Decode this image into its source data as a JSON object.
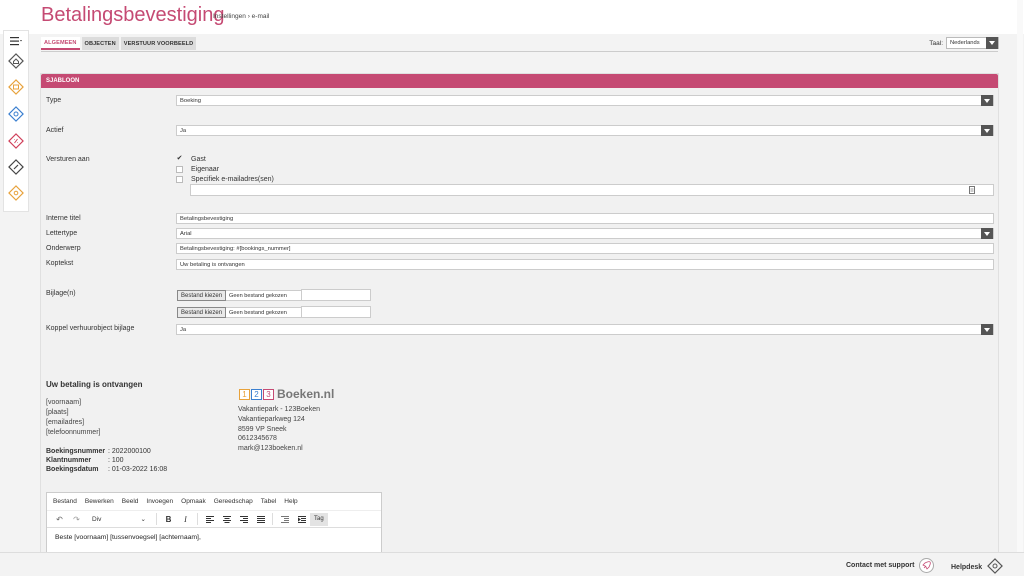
{
  "header": {
    "title": "Betalingsbevestiging",
    "breadcrumb": "Instellingen › e-mail"
  },
  "tabs": [
    {
      "label": "ALGEMEEN",
      "active": true
    },
    {
      "label": "OBJECTEN",
      "active": false
    },
    {
      "label": "VERSTUUR VOORBEELD",
      "active": false
    }
  ],
  "language": {
    "label": "Taal:",
    "value": "Nederlands"
  },
  "section": {
    "title": "SJABLOON"
  },
  "form": {
    "type": {
      "label": "Type",
      "value": "Boeking"
    },
    "actief": {
      "label": "Actief",
      "value": "Ja"
    },
    "versturen": {
      "label": "Versturen aan",
      "options": [
        {
          "label": "Gast",
          "checked": true
        },
        {
          "label": "Eigenaar",
          "checked": false
        },
        {
          "label": "Specifiek e-mailadres(sen)",
          "checked": false
        }
      ],
      "email_value": ""
    },
    "interne_titel": {
      "label": "Interne titel",
      "value": "Betalingsbevestiging"
    },
    "lettertype": {
      "label": "Lettertype",
      "value": "Arial"
    },
    "onderwerp": {
      "label": "Onderwerp",
      "value": "Betalingsbevestiging: #[bookings_nummer]"
    },
    "koptekst": {
      "label": "Koptekst",
      "value": "Uw betaling is ontvangen"
    },
    "bijlagen": {
      "label": "Bijlage(n)",
      "button": "Bestand kiezen",
      "none_chosen": "Geen bestand gekozen"
    },
    "koppel": {
      "label": "Koppel verhuurobject bijlage",
      "value": "Ja"
    }
  },
  "preview": {
    "title": "Uw betaling is ontvangen",
    "placeholders": [
      "[voornaam]",
      "[plaats]",
      "[emailadres]",
      "[telefoonnummer]"
    ],
    "details": [
      {
        "key": "Boekingsnummer",
        "value": ": 2022000100"
      },
      {
        "key": "Klantnummer",
        "value": ": 100"
      },
      {
        "key": "Boekingsdatum",
        "value": ": 01-03-2022 16:08"
      }
    ],
    "logo": {
      "d1": "1",
      "d2": "2",
      "d3": "3",
      "brand": "Boeken.nl"
    },
    "address": [
      "Vakantiepark - 123Boeken",
      "Vakantieparkweg 124",
      "8599 VP Sneek",
      "0612345678",
      "mark@123boeken.nl"
    ]
  },
  "editor": {
    "menu": [
      "Bestand",
      "Bewerken",
      "Beeld",
      "Invoegen",
      "Opmaak",
      "Gereedschap",
      "Tabel",
      "Help"
    ],
    "format": "Div",
    "tag_button": "Tag",
    "body": "Beste [voornaam] [tussenvoegsel] [achternaam],"
  },
  "footer": {
    "support": "Contact met support",
    "helpdesk": "Helpdesk"
  },
  "colors": {
    "accent": "#c54a73"
  }
}
